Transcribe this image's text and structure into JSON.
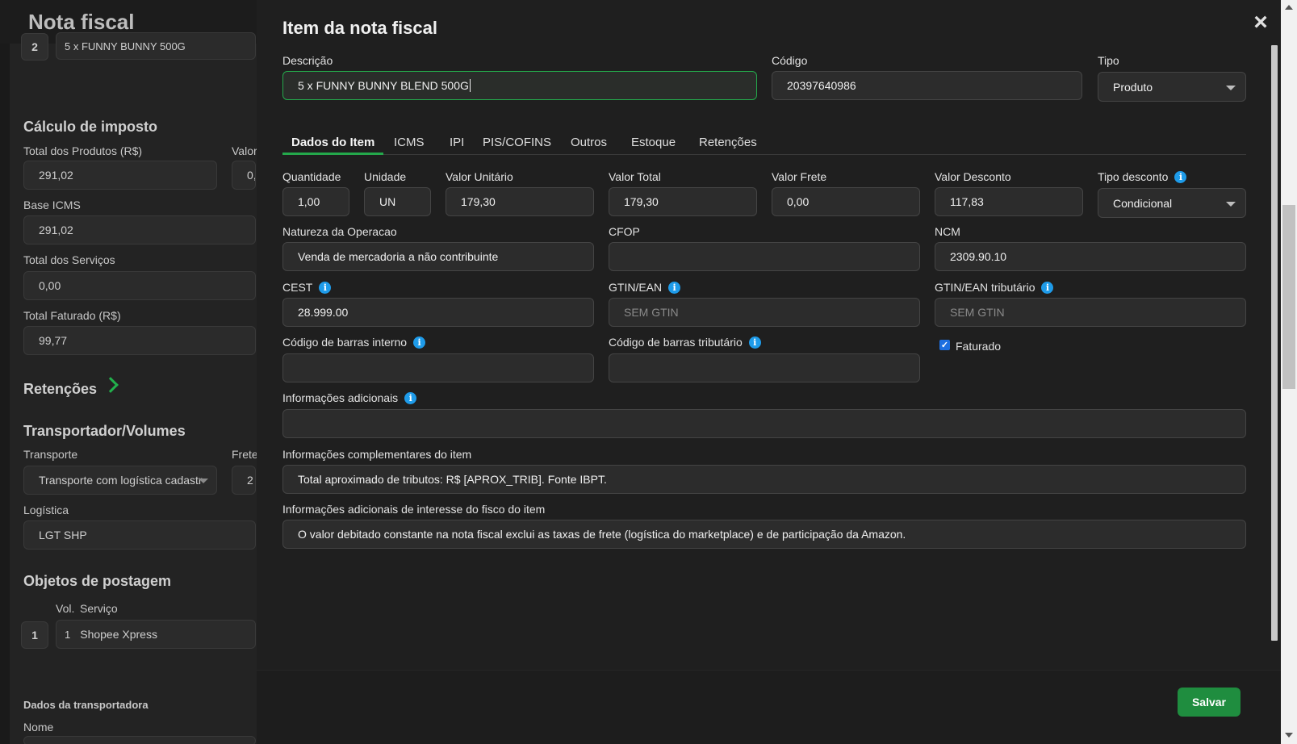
{
  "background": {
    "title": "Nota fiscal",
    "item_number": "2",
    "item_description": "5 x FUNNY BUNNY 500G",
    "tax_section": "Cálculo de imposto",
    "total_produtos_label": "Total dos Produtos (R$)",
    "total_produtos_value": "291,02",
    "valor_label": "Valor",
    "valor_value": "0,",
    "base_icms_label": "Base ICMS",
    "base_icms_value": "291,02",
    "total_servicos_label": "Total dos Serviços",
    "total_servicos_value": "0,00",
    "total_faturado_label": "Total Faturado (R$)",
    "total_faturado_value": "99,77",
    "retencoes_section": "Retenções",
    "transportador_section": "Transportador/Volumes",
    "transporte_label": "Transporte",
    "transporte_value": "Transporte com logística cadastr",
    "frete_label": "Frete",
    "frete_value": "2",
    "logistica_label": "Logística",
    "logistica_value": "LGT SHP",
    "objetos_section": "Objetos de postagem",
    "vol_label": "Vol.",
    "servico_label": "Serviço",
    "objeto_number": "1",
    "objeto_vol": "1",
    "objeto_servico": "Shopee Xpress",
    "dados_transportadora": "Dados da transportadora",
    "nome_label": "Nome"
  },
  "modal": {
    "title": "Item da nota fiscal",
    "close_icon": "×",
    "descricao_label": "Descrição",
    "descricao_value": "5 x FUNNY BUNNY BLEND 500G",
    "codigo_label": "Código",
    "codigo_value": "20397640986",
    "tipo_label": "Tipo",
    "tipo_value": "Produto",
    "tabs": [
      "Dados do Item",
      "ICMS",
      "IPI",
      "PIS/COFINS",
      "Outros",
      "Estoque",
      "Retenções"
    ],
    "active_tab": "Dados do Item",
    "quantidade_label": "Quantidade",
    "quantidade_value": "1,00",
    "unidade_label": "Unidade",
    "unidade_value": "UN",
    "valor_unitario_label": "Valor Unitário",
    "valor_unitario_value": "179,30",
    "valor_total_label": "Valor Total",
    "valor_total_value": "179,30",
    "valor_frete_label": "Valor Frete",
    "valor_frete_value": "0,00",
    "valor_desconto_label": "Valor Desconto",
    "valor_desconto_value": "117,83",
    "tipo_desconto_label": "Tipo desconto",
    "tipo_desconto_value": "Condicional",
    "natureza_label": "Natureza da Operacao",
    "natureza_value": "Venda de mercadoria a não contribuinte",
    "cfop_label": "CFOP",
    "cfop_value": "",
    "ncm_label": "NCM",
    "ncm_value": "2309.90.10",
    "cest_label": "CEST",
    "cest_value": "28.999.00",
    "gtin_label": "GTIN/EAN",
    "gtin_placeholder": "SEM GTIN",
    "gtin_trib_label": "GTIN/EAN tributário",
    "gtin_trib_placeholder": "SEM GTIN",
    "cod_barras_interno_label": "Código de barras interno",
    "cod_barras_tributario_label": "Código de barras tributário",
    "faturado_label": "Faturado",
    "faturado_checked": true,
    "info_adicionais_label": "Informações adicionais",
    "info_complementares_label": "Informações complementares do item",
    "info_complementares_value": "Total aproximado de tributos: R$ [APROX_TRIB]. Fonte IBPT.",
    "info_fisco_label": "Informações adicionais de interesse do fisco do item",
    "info_fisco_value": "O valor debitado constante na nota fiscal exclui as taxas de frete (logística do marketplace) e de participação da Amazon.",
    "save_label": "Salvar",
    "info_icon": "i"
  },
  "colors": {
    "accent": "#24a84b",
    "save_button": "#1f8d3f",
    "info_icon": "#1e9be9",
    "checkbox": "#1e6fe0"
  }
}
